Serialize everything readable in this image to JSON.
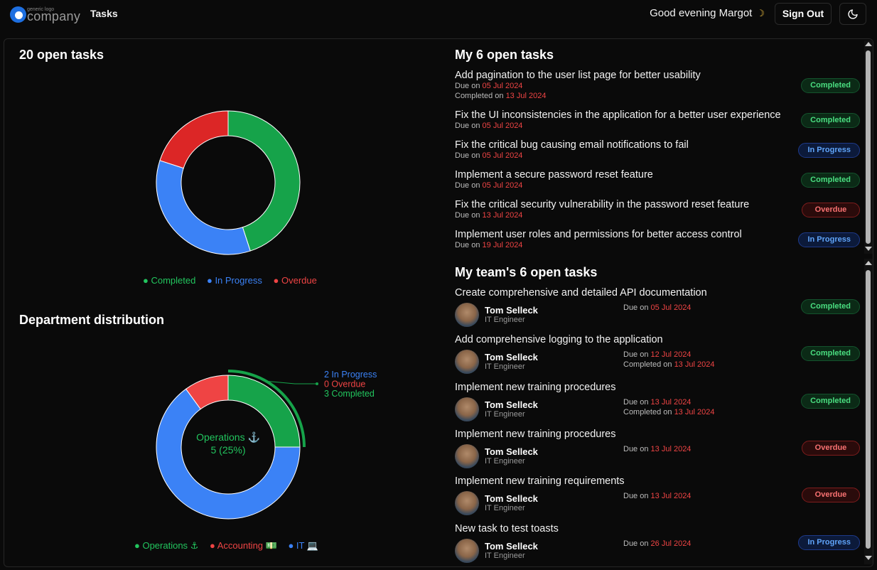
{
  "nav": {
    "logo_small": "generic logo",
    "logo_word": "company",
    "tasks_link": "Tasks",
    "greeting": "Good evening Margot",
    "moon": "☽",
    "sign_out": "Sign Out",
    "theme_icon": "moon-icon"
  },
  "colors": {
    "completed": "#16a34a",
    "in_progress": "#3b82f6",
    "overdue": "#dc2626"
  },
  "open_tasks_chart": {
    "title": "20 open tasks",
    "chart_data": {
      "type": "pie",
      "categories": [
        "Completed",
        "In Progress",
        "Overdue"
      ],
      "values": [
        9,
        7,
        4
      ],
      "donut": true
    },
    "legend": [
      "Completed",
      "In Progress",
      "Overdue"
    ]
  },
  "department_chart": {
    "title": "Department distribution",
    "chart_data": {
      "type": "pie",
      "categories": [
        "Operations ⚓",
        "Accounting 💵",
        "IT 💻"
      ],
      "values": [
        5,
        2,
        13
      ],
      "donut": true
    },
    "center_label": "Operations ⚓",
    "center_value": "5 (25%)",
    "callout": [
      "2 In Progress",
      "0 Overdue",
      "3 Completed"
    ],
    "legend": [
      "Operations ⚓",
      "Accounting 💵",
      "IT 💻"
    ]
  },
  "my_tasks": {
    "heading": "My 6 open tasks",
    "items": [
      {
        "title": "Add pagination to the user list page for better usability",
        "due_label": "Due on",
        "due": "05 Jul 2024",
        "done_label": "Completed on",
        "done": "13 Jul 2024",
        "status": "Completed"
      },
      {
        "title": "Fix the UI inconsistencies in the application for a better user experience",
        "due_label": "Due on",
        "due": "05 Jul 2024",
        "status": "Completed"
      },
      {
        "title": "Fix the critical bug causing email notifications to fail",
        "due_label": "Due on",
        "due": "05 Jul 2024",
        "status": "In Progress"
      },
      {
        "title": "Implement a secure password reset feature",
        "due_label": "Due on",
        "due": "05 Jul 2024",
        "status": "Completed"
      },
      {
        "title": "Fix the critical security vulnerability in the password reset feature",
        "due_label": "Due on",
        "due": "13 Jul 2024",
        "status": "Overdue"
      },
      {
        "title": "Implement user roles and permissions for better access control",
        "due_label": "Due on",
        "due": "19 Jul 2024",
        "status": "In Progress"
      }
    ]
  },
  "team_tasks": {
    "heading": "My team's 6 open tasks",
    "items": [
      {
        "title": "Create comprehensive and detailed API documentation",
        "name": "Tom Selleck",
        "role": "IT Engineer",
        "due_label": "Due on",
        "due": "05 Jul 2024",
        "status": "Completed"
      },
      {
        "title": "Add comprehensive logging to the application",
        "name": "Tom Selleck",
        "role": "IT Engineer",
        "due_label": "Due on",
        "due": "12 Jul 2024",
        "done_label": "Completed on",
        "done": "13 Jul 2024",
        "status": "Completed"
      },
      {
        "title": "Implement new training procedures",
        "name": "Tom Selleck",
        "role": "IT Engineer",
        "due_label": "Due on",
        "due": "13 Jul 2024",
        "done_label": "Completed on",
        "done": "13 Jul 2024",
        "status": "Completed"
      },
      {
        "title": "Implement new training procedures",
        "name": "Tom Selleck",
        "role": "IT Engineer",
        "due_label": "Due on",
        "due": "13 Jul 2024",
        "status": "Overdue"
      },
      {
        "title": "Implement new training requirements",
        "name": "Tom Selleck",
        "role": "IT Engineer",
        "due_label": "Due on",
        "due": "13 Jul 2024",
        "status": "Overdue"
      },
      {
        "title": "New task to test toasts",
        "name": "Tom Selleck",
        "role": "IT Engineer",
        "due_label": "Due on",
        "due": "26 Jul 2024",
        "status": "In Progress"
      }
    ]
  }
}
